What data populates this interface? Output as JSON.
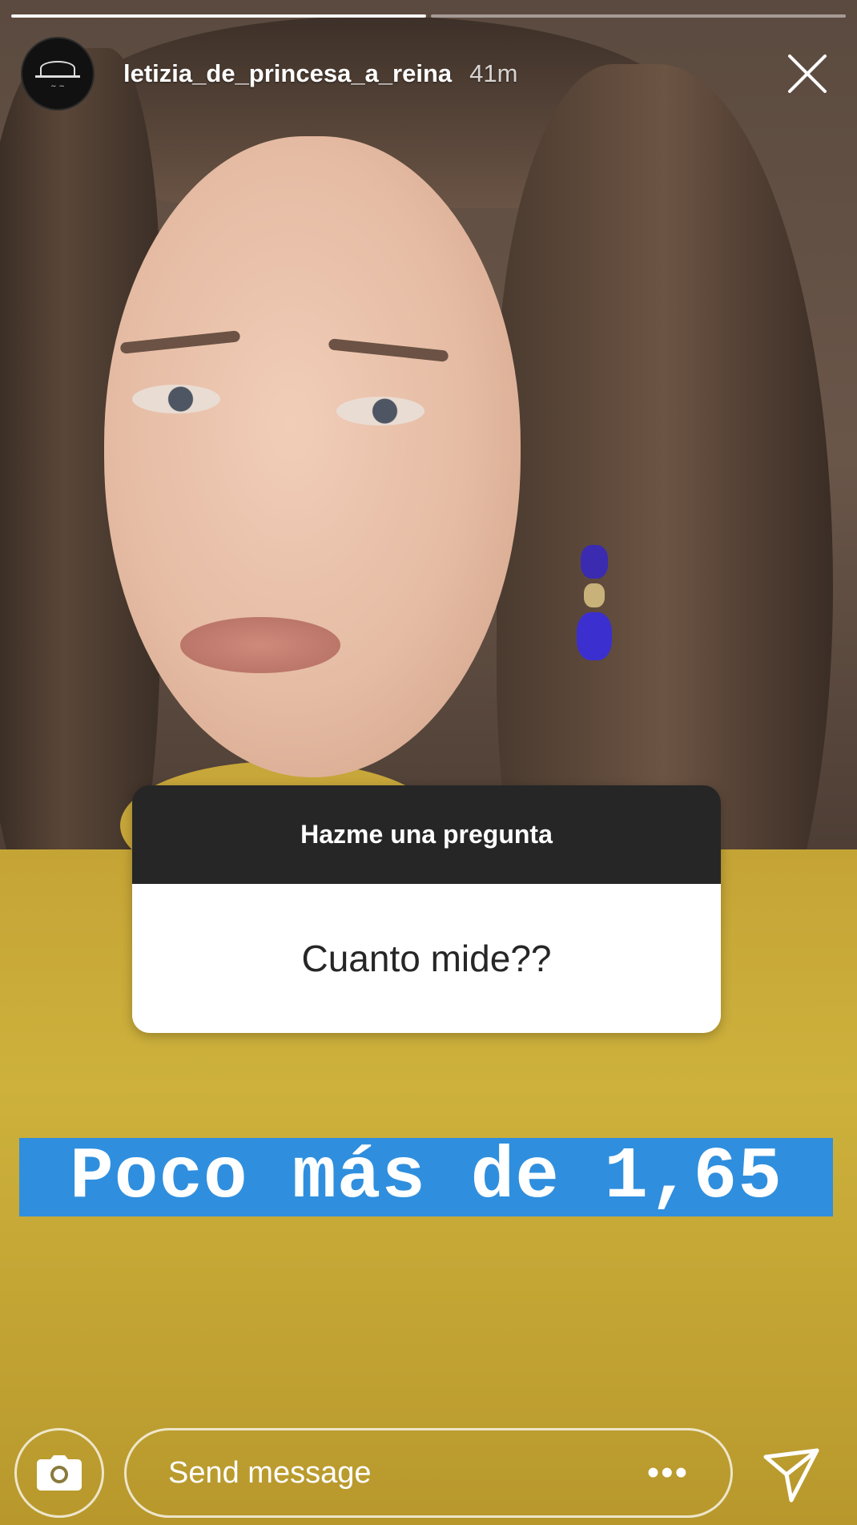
{
  "story": {
    "progress_segments": 2,
    "progress_current": 1
  },
  "header": {
    "username": "letizia_de_princesa_a_reina",
    "time": "41m"
  },
  "question_sticker": {
    "title": "Hazme una pregunta",
    "question": "Cuanto mide??"
  },
  "answer_text": "Poco más de 1,65",
  "footer": {
    "message_placeholder": "Send message",
    "more_label": "•••"
  },
  "icons": {
    "close": "close-icon",
    "camera": "camera-icon",
    "send": "send-icon"
  },
  "colors": {
    "answer_highlight": "#2f8fde",
    "sticker_header": "#262626"
  }
}
